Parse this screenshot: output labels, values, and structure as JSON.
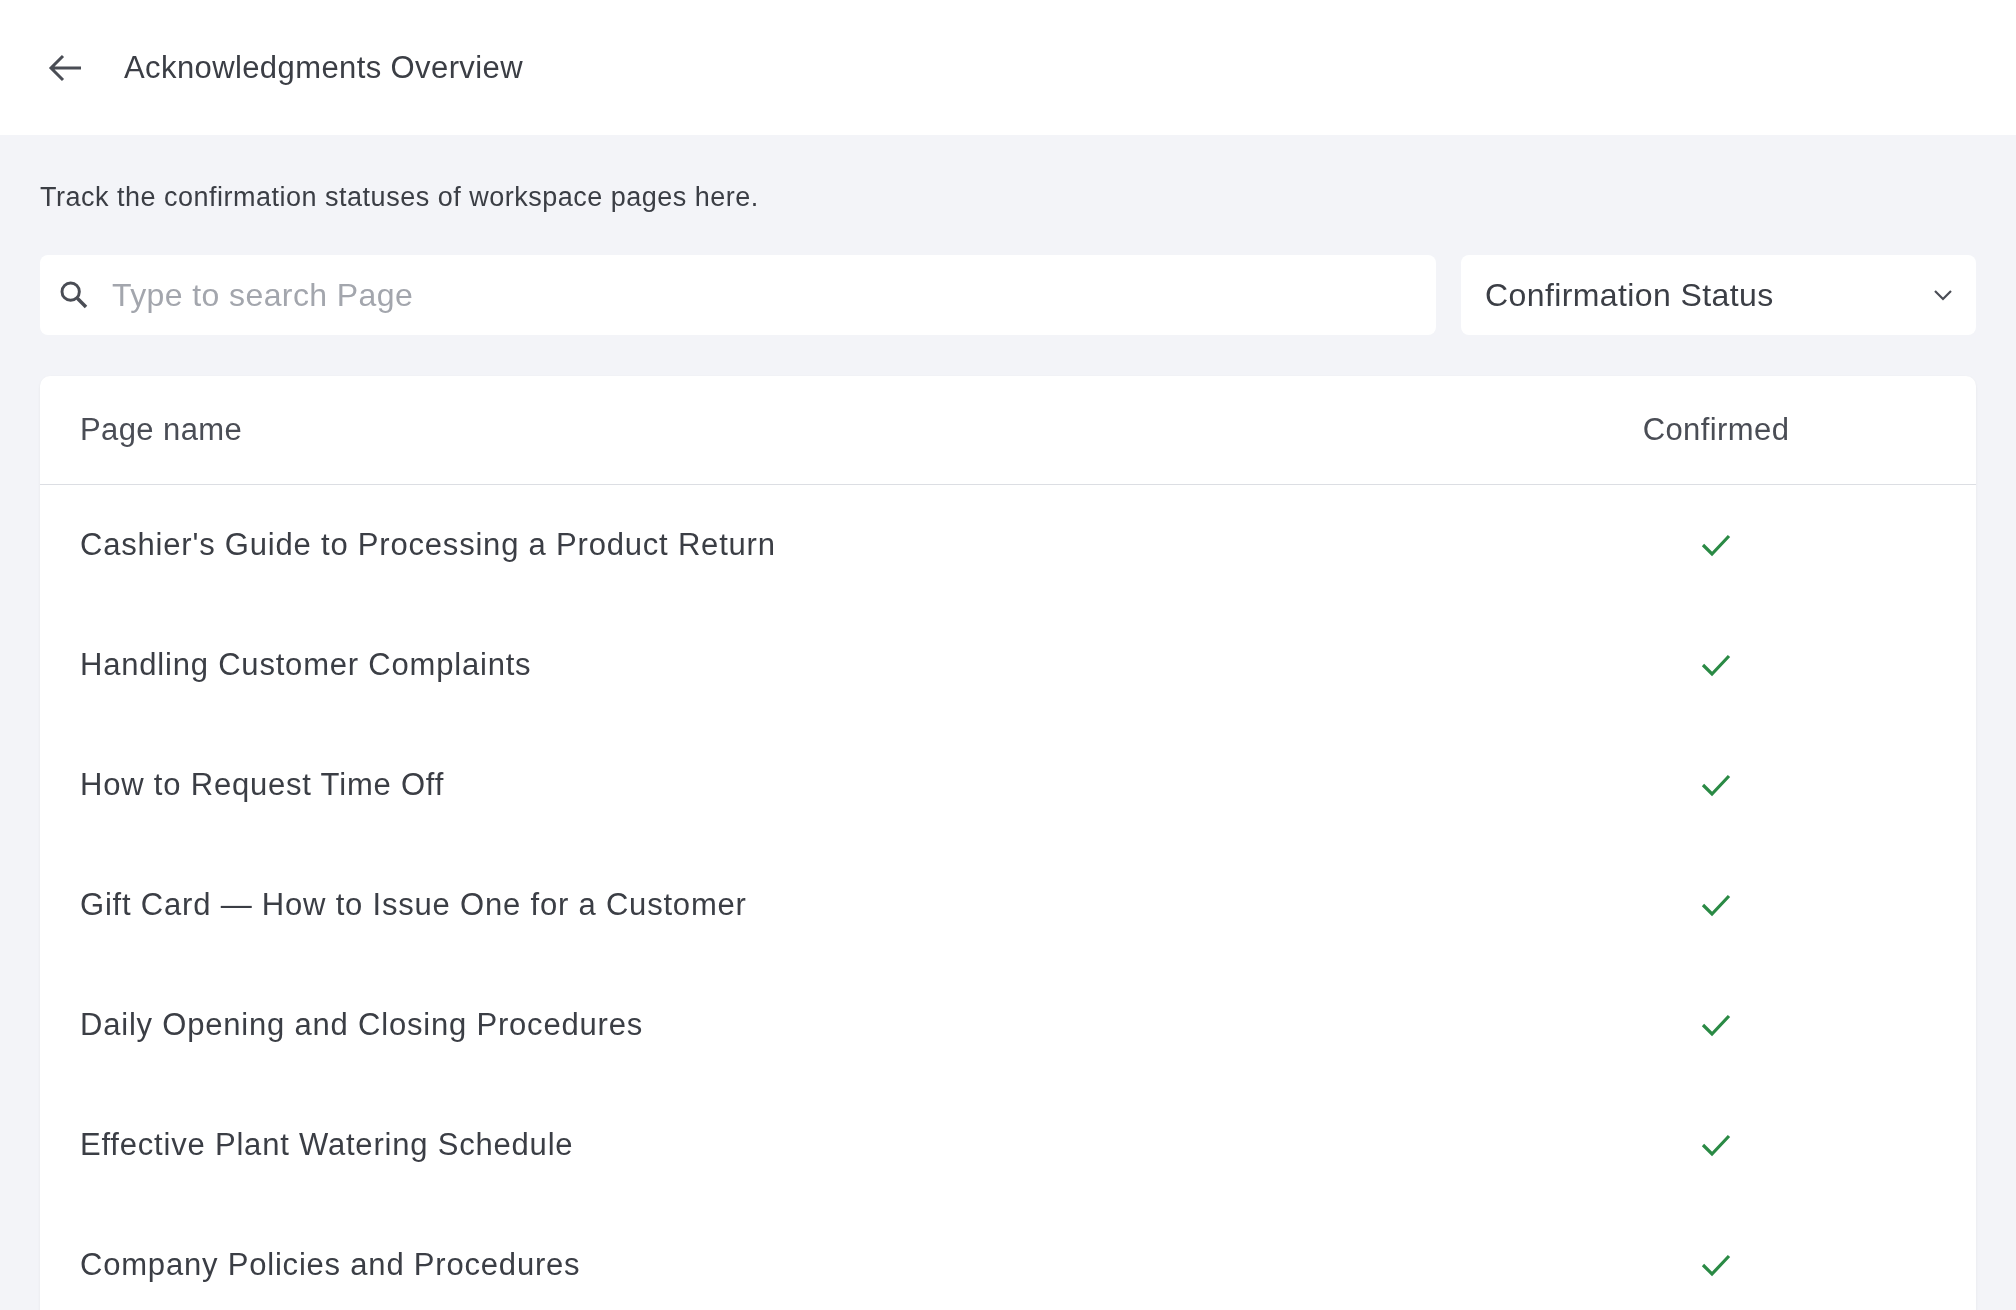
{
  "header": {
    "title": "Acknowledgments Overview"
  },
  "description": "Track the confirmation statuses of workspace pages here.",
  "search": {
    "placeholder": "Type to search Page"
  },
  "filter": {
    "label": "Confirmation Status"
  },
  "table": {
    "columns": [
      "Page name",
      "Confirmed"
    ],
    "rows": [
      {
        "name": "Cashier's Guide to Processing a Product Return",
        "confirmed": true
      },
      {
        "name": "Handling Customer Complaints",
        "confirmed": true
      },
      {
        "name": "How to Request Time Off",
        "confirmed": true
      },
      {
        "name": "Gift Card — How to Issue One for a Customer",
        "confirmed": true
      },
      {
        "name": "Daily Opening and Closing Procedures",
        "confirmed": true
      },
      {
        "name": "Effective Plant Watering Schedule",
        "confirmed": true
      },
      {
        "name": "Company Policies and Procedures",
        "confirmed": true
      }
    ]
  }
}
